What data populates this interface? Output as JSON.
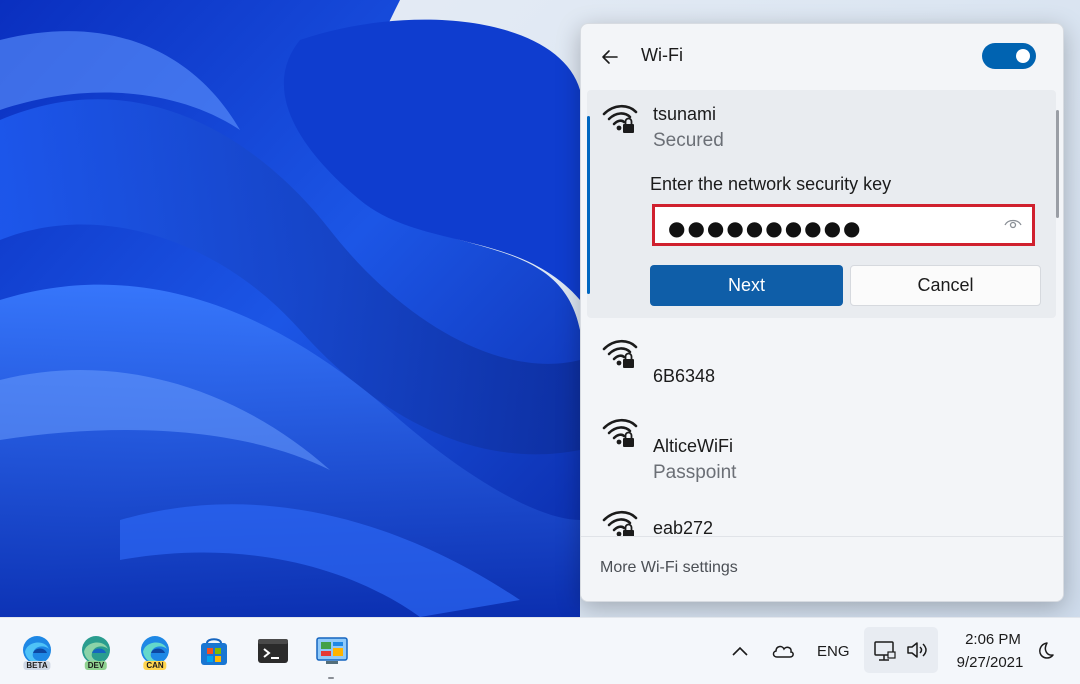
{
  "wifi_flyout": {
    "title": "Wi-Fi",
    "toggle_on": true,
    "accent_color": "#0067c0",
    "expanded_network": {
      "name": "tsunami",
      "status": "Secured",
      "key_label": "Enter the network security key",
      "password_masked": "●●●●●●●●●●",
      "next_label": "Next",
      "cancel_label": "Cancel"
    },
    "networks": [
      {
        "name": "6B6348",
        "status": ""
      },
      {
        "name": "AlticeWiFi",
        "status": "Passpoint"
      },
      {
        "name": "eab272",
        "status": ""
      }
    ],
    "footer_link": "More Wi-Fi settings"
  },
  "taskbar": {
    "apps": [
      {
        "name": "edge-beta",
        "badge": "BETA"
      },
      {
        "name": "edge-dev",
        "badge": "DEV"
      },
      {
        "name": "edge-canary",
        "badge": "CAN"
      },
      {
        "name": "microsoft-store",
        "badge": ""
      },
      {
        "name": "terminal",
        "badge": ""
      },
      {
        "name": "control-panel",
        "badge": ""
      }
    ],
    "tray": {
      "language": "ENG",
      "time": "2:06 PM",
      "date": "9/27/2021"
    }
  }
}
